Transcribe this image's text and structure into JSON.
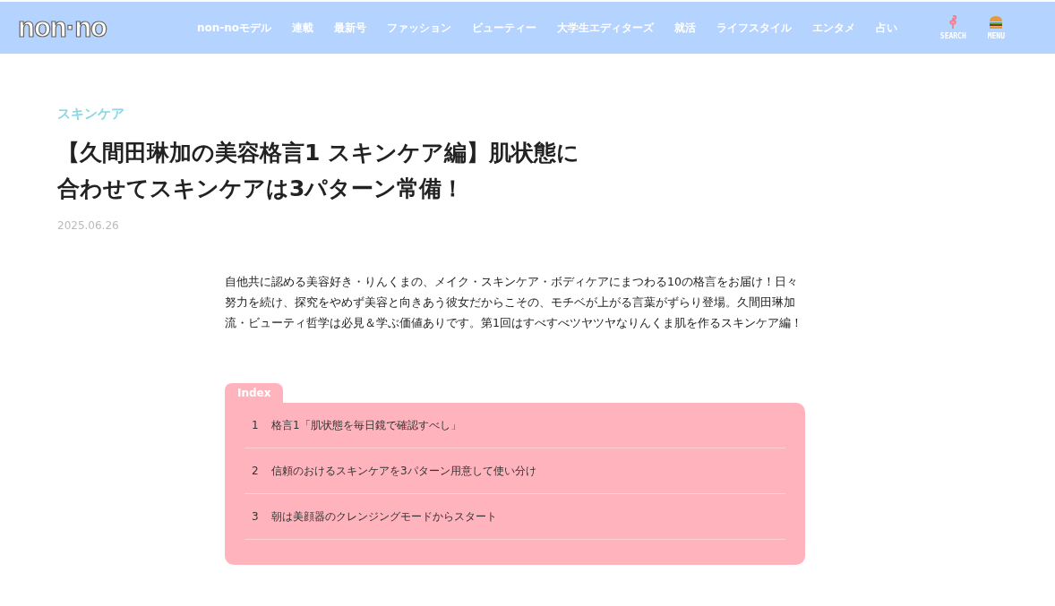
{
  "header": {
    "logo": "non·no",
    "nav": [
      "non-noモデル",
      "連載",
      "最新号",
      "ファッション",
      "ビューティー",
      "大学生エディターズ",
      "就活",
      "ライフスタイル",
      "エンタメ",
      "占い"
    ],
    "actions": [
      {
        "kind": "search",
        "label": "SEARCH"
      },
      {
        "kind": "menu",
        "label": "MENU"
      }
    ]
  },
  "article": {
    "category": "スキンケア",
    "title_lines": [
      "【久間田琳加の美容格言1 スキンケア編】肌状態に",
      "合わせてスキンケアは3パターン常備！"
    ],
    "date": "2025.06.26",
    "lead": "自他共に認める美容好き・りんくまの、メイク・スキンケア・ボディケアにまつわる10の格言をお届け！日々努力を続け、探究をやめず美容と向きあう彼女だからこその、モチベが上がる言葉がずらり登場。久間田琳加流・ビューティ哲学は必見＆学ぶ価値ありです。第1回はすべすべツヤツヤなりんくま肌を作るスキンケア編！"
  },
  "index": {
    "label": "Index",
    "items": [
      {
        "number": "1",
        "text": "格言1「肌状態を毎日鏡で確認すべし」"
      },
      {
        "number": "2",
        "text": "信頼のおけるスキンケアを3パターン用意して使い分け"
      },
      {
        "number": "3",
        "text": "朝は美顔器のクレンジングモードからスタート"
      }
    ]
  }
}
